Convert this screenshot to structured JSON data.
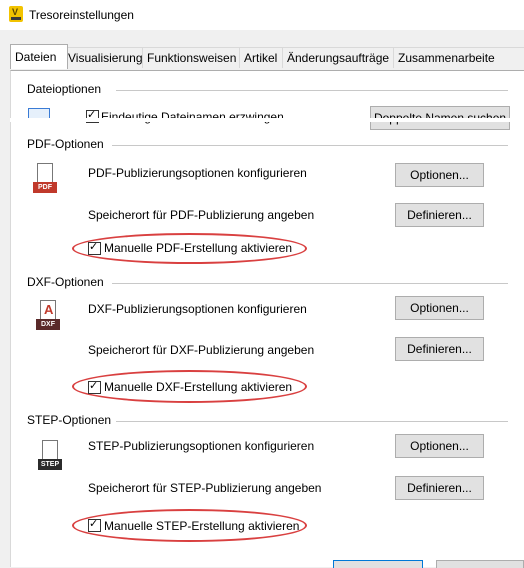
{
  "window": {
    "title": "Tresoreinstellungen"
  },
  "tabs": [
    "Dateien",
    "Visualisierung",
    "Funktionsweisen",
    "Artikel",
    "Änderungsaufträge",
    "Zusammenarbeite"
  ],
  "dateioptionen": {
    "title": "Dateioptionen",
    "checkbox_label": "Eindeutige Dateinamen erzwingen",
    "button_label": "Doppelte Namen suchen"
  },
  "pdf": {
    "title": "PDF-Optionen",
    "icon_text": "PDF",
    "configure_label": "PDF-Publizierungsoptionen konfigurieren",
    "options_button": "Optionen...",
    "location_label": "Speicherort für PDF-Publizierung angeben",
    "define_button": "Definieren...",
    "manual_label": "Manuelle PDF-Erstellung aktivieren"
  },
  "dxf": {
    "title": "DXF-Optionen",
    "icon_text": "DXF",
    "configure_label": "DXF-Publizierungsoptionen konfigurieren",
    "options_button": "Optionen...",
    "location_label": "Speicherort für DXF-Publizierung angeben",
    "define_button": "Definieren...",
    "manual_label": "Manuelle DXF-Erstellung aktivieren"
  },
  "step": {
    "title": "STEP-Optionen",
    "icon_text": "STEP",
    "configure_label": "STEP-Publizierungsoptionen konfigurieren",
    "options_button": "Optionen...",
    "location_label": "Speicherort für STEP-Publizierung angeben",
    "define_button": "Definieren...",
    "manual_label": "Manuelle STEP-Erstellung aktivieren"
  },
  "colors": {
    "highlight": "#d94040",
    "pdf_red": "#c0392b",
    "dxf_dark": "#5a2a2a",
    "step_dark": "#2b2b2b"
  }
}
